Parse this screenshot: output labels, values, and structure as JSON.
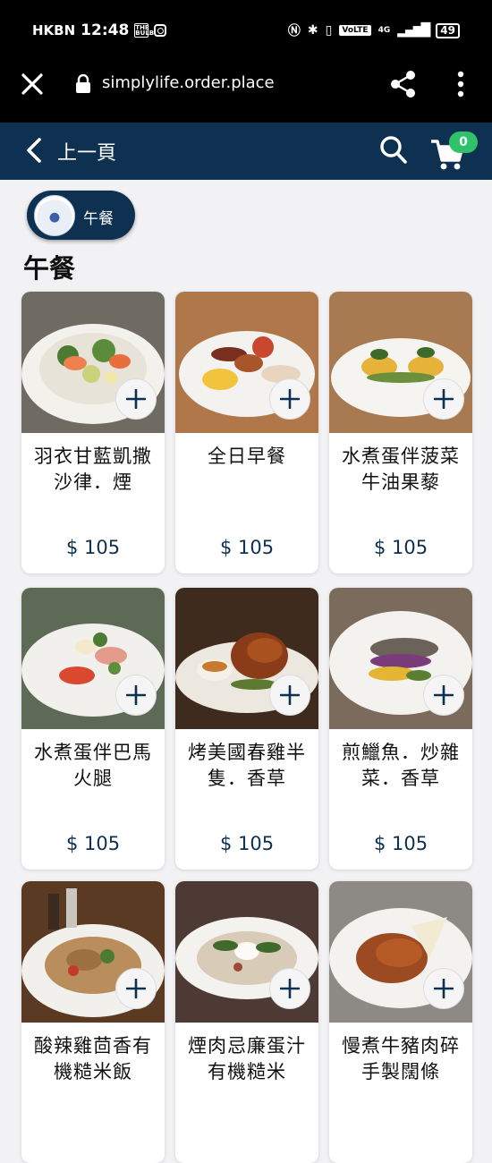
{
  "status_bar": {
    "carrier": "HKBN",
    "time": "12:48",
    "mini_badge": "THE BULB",
    "network": "4G",
    "volte": "VoLTE",
    "battery": "49"
  },
  "browser": {
    "url": "simplylife.order.place",
    "icons": [
      "close-icon",
      "lock-icon",
      "share-icon",
      "more-icon"
    ]
  },
  "header": {
    "back_label": "上一頁",
    "cart_count": "0",
    "colors": {
      "bar": "#0e3152",
      "badge": "#2fc26b"
    }
  },
  "category": {
    "chip_label": "午餐",
    "section_title": "午餐"
  },
  "menu_items": [
    {
      "name": "羽衣甘藍凱撒沙律．煙",
      "price": "$ 105"
    },
    {
      "name": "全日早餐",
      "price": "$ 105"
    },
    {
      "name": "水煮蛋伴菠菜牛油果藜",
      "price": "$ 105"
    },
    {
      "name": "水煮蛋伴巴馬火腿",
      "price": "$ 105"
    },
    {
      "name": "烤美國春雞半隻．香草",
      "price": "$ 105"
    },
    {
      "name": "煎鱲魚．炒雜菜．香草",
      "price": "$ 105"
    },
    {
      "name": "酸辣雞茴香有機糙米飯",
      "price": ""
    },
    {
      "name": "煙肉忌廉蛋汁有機糙米",
      "price": ""
    },
    {
      "name": "慢煮牛豬肉碎手製闊條",
      "price": ""
    }
  ]
}
